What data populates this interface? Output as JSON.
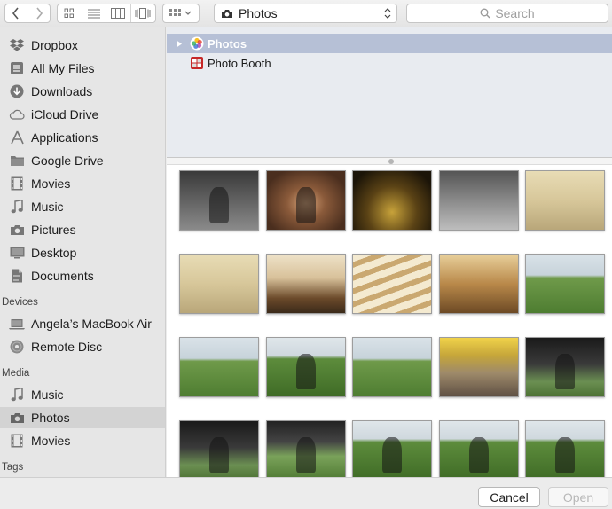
{
  "toolbar": {
    "path_label": "Photos",
    "search_placeholder": "Search"
  },
  "sidebar": {
    "favorites": [
      {
        "label": "Dropbox",
        "icon": "dropbox-icon"
      },
      {
        "label": "All My Files",
        "icon": "all-files-icon"
      },
      {
        "label": "Downloads",
        "icon": "downloads-icon"
      },
      {
        "label": "iCloud Drive",
        "icon": "cloud-icon"
      },
      {
        "label": "Applications",
        "icon": "applications-icon"
      },
      {
        "label": "Google Drive",
        "icon": "folder-icon"
      },
      {
        "label": "Movies",
        "icon": "film-icon"
      },
      {
        "label": "Music",
        "icon": "music-note-icon"
      },
      {
        "label": "Pictures",
        "icon": "camera-icon"
      },
      {
        "label": "Desktop",
        "icon": "desktop-icon"
      },
      {
        "label": "Documents",
        "icon": "document-icon"
      }
    ],
    "devices_heading": "Devices",
    "devices": [
      {
        "label": "Angela’s MacBook Air",
        "icon": "laptop-icon"
      },
      {
        "label": "Remote Disc",
        "icon": "disc-icon"
      }
    ],
    "media_heading": "Media",
    "media": [
      {
        "label": "Music",
        "icon": "music-note-icon"
      },
      {
        "label": "Photos",
        "icon": "camera-icon",
        "selected": true
      },
      {
        "label": "Movies",
        "icon": "film-icon"
      }
    ],
    "tags_heading": "Tags"
  },
  "browser": {
    "rows": [
      {
        "label": "Photos",
        "icon": "photos-app-icon",
        "selected": true
      },
      {
        "label": "Photo Booth",
        "icon": "photo-booth-icon",
        "selected": false
      }
    ]
  },
  "thumbnails": [
    {
      "theme": "mono"
    },
    {
      "theme": "indoor-dark"
    },
    {
      "theme": "night"
    },
    {
      "theme": "mono-room"
    },
    {
      "theme": "beige-room"
    },
    {
      "theme": "beige-room"
    },
    {
      "theme": "living-room"
    },
    {
      "theme": "stairs"
    },
    {
      "theme": "dining"
    },
    {
      "theme": "lawn"
    },
    {
      "theme": "lawn"
    },
    {
      "theme": "lawn-people"
    },
    {
      "theme": "lawn"
    },
    {
      "theme": "porch"
    },
    {
      "theme": "car"
    },
    {
      "theme": "car"
    },
    {
      "theme": "car-lawn"
    },
    {
      "theme": "lawn-people"
    },
    {
      "theme": "lawn-people"
    },
    {
      "theme": "lawn-people"
    }
  ],
  "footer": {
    "cancel_label": "Cancel",
    "open_label": "Open"
  }
}
